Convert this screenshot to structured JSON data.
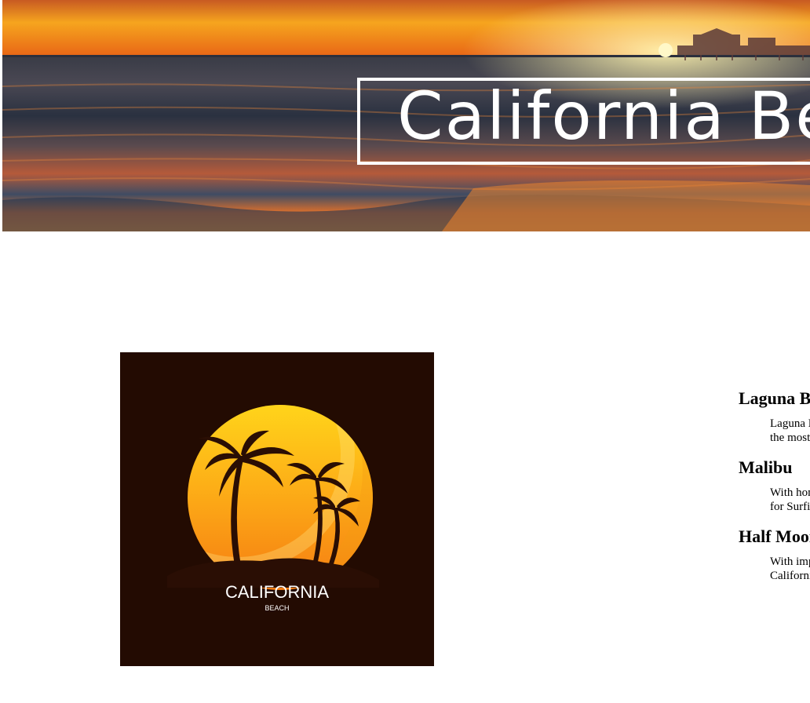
{
  "header": {
    "title": "California Beaches",
    "banner": "sunset-ocean-banner"
  },
  "poster": {
    "title": "CALIFORNIA",
    "subtitle": "BEACH",
    "colors": {
      "background": "#230b02",
      "sun_top": "#ffd21a",
      "sun_bottom": "#f57c12",
      "palm": "#2a0e04"
    }
  },
  "beaches": [
    {
      "name": "Laguna Beach",
      "description": "Laguna Beach is known for its hidden coves and is one of the most romantic"
    },
    {
      "name": "Malibu",
      "description": "With homes of celebrities lining the coast, Malibu, famous for Surfing and Country"
    },
    {
      "name": "Half Moon Bay",
      "description": "With impressive surf breaks you can experience some of California's most famous"
    }
  ]
}
